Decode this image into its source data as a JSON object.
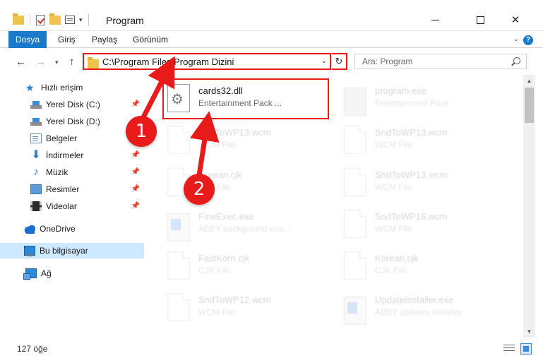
{
  "window": {
    "title": "Program",
    "minimize_glyph": "",
    "close_glyph": "✕"
  },
  "ribbon": {
    "tabs": [
      {
        "label": "Dosya",
        "active": true
      },
      {
        "label": "Giriş"
      },
      {
        "label": "Paylaş"
      },
      {
        "label": "Görünüm"
      }
    ],
    "help_glyph": "?",
    "collapse_glyph": "⌄"
  },
  "navigation": {
    "back_glyph": "←",
    "forward_glyph": "→",
    "recent_glyph": "▾",
    "up_glyph": "↑",
    "address": "C:\\Program Files\\Program Dizini",
    "address_dropdown_glyph": "⌄",
    "refresh_glyph": "↻",
    "search_placeholder": "Ara: Program"
  },
  "sidebar": {
    "pin_glyph": "📌",
    "items": [
      {
        "label": "Hızlı erişim",
        "icon": "star-icon",
        "glyph": "★",
        "pinned": false
      },
      {
        "label": "Yerel Disk (C:)",
        "icon": "drive-icon",
        "pinned": true
      },
      {
        "label": "Yerel Disk (D:)",
        "icon": "drive-icon",
        "pinned": false
      },
      {
        "label": "Belgeler",
        "icon": "documents-icon",
        "pinned": true
      },
      {
        "label": "İndirmeler",
        "icon": "download-icon",
        "glyph": "⬇",
        "pinned": true
      },
      {
        "label": "Müzik",
        "icon": "music-icon",
        "glyph": "♪",
        "pinned": true
      },
      {
        "label": "Resimler",
        "icon": "pictures-icon",
        "pinned": true
      },
      {
        "label": "Videolar",
        "icon": "videos-icon",
        "pinned": true
      },
      {
        "label": "OneDrive",
        "icon": "cloud-icon",
        "pinned": false
      },
      {
        "label": "Bu bilgisayar",
        "icon": "computer-icon",
        "pinned": false,
        "selected": true
      },
      {
        "label": "Ağ",
        "icon": "network-icon",
        "pinned": false
      }
    ]
  },
  "files": [
    {
      "name": "cards32.dll",
      "type": "Entertainment Pack ...",
      "icon": "dll-gear-icon",
      "highlighted": true
    },
    {
      "name": "program.exe",
      "type": "Entertainment Pack",
      "icon": "exe-icon",
      "faded": true
    },
    {
      "name": "SndToWP13.wcm",
      "type": "WCM File",
      "icon": "file-icon",
      "faded": true
    },
    {
      "name": "SndToWP13.wcm",
      "type": "WCM File",
      "icon": "file-icon",
      "faded": true
    },
    {
      "name": "Korean.cjk",
      "type": "CJK File",
      "icon": "file-icon",
      "faded": true
    },
    {
      "name": "SndToWP13.wcm",
      "type": "WCM File",
      "icon": "file-icon",
      "faded": true
    },
    {
      "name": "FineExec.exe",
      "type": "ABBY background exe...",
      "icon": "app-icon",
      "faded": true
    },
    {
      "name": "SndToWP16.wcm",
      "type": "WCM File",
      "icon": "file-icon",
      "faded": true
    },
    {
      "name": "FastKorn.cjk",
      "type": "CJK File",
      "icon": "file-icon",
      "faded": true
    },
    {
      "name": "Korean.cjk",
      "type": "CJK File",
      "icon": "file-icon",
      "faded": true
    },
    {
      "name": "SndToWP12.wcm",
      "type": "WCM File",
      "icon": "file-icon",
      "faded": true
    },
    {
      "name": "UpdateInstaller.exe",
      "type": "ABBY updates installer",
      "icon": "app-icon",
      "faded": true
    }
  ],
  "scrollbar": {
    "up_glyph": "▲",
    "down_glyph": "▼"
  },
  "status": {
    "item_count": "127 öğe"
  },
  "annotations": [
    {
      "number": "1"
    },
    {
      "number": "2"
    }
  ],
  "colors": {
    "accent": "#1979ca",
    "highlight": "#e81a1a",
    "selected_bg": "#cde8ff"
  }
}
